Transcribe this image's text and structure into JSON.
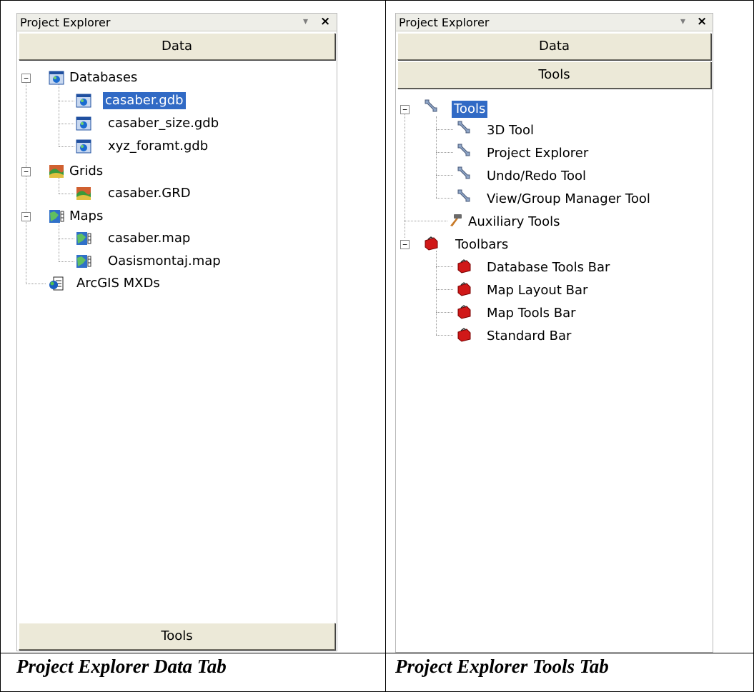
{
  "left_panel": {
    "title": "Project Explorer",
    "pin_glyph": "▾",
    "close_glyph": "×",
    "tab_top": "Data",
    "tab_bottom": "Tools",
    "tree": {
      "databases": "Databases",
      "db1": "casaber.gdb",
      "db2": "casaber_size.gdb",
      "db3": "xyz_foramt.gdb",
      "grids": "Grids",
      "grid1": "casaber.GRD",
      "maps": "Maps",
      "map1": "casaber.map",
      "map2": "Oasismontaj.map",
      "arcgis": "ArcGIS MXDs"
    }
  },
  "right_panel": {
    "title": "Project Explorer",
    "pin_glyph": "▾",
    "close_glyph": "×",
    "tab_data": "Data",
    "tab_tools": "Tools",
    "tree": {
      "tools": "Tools",
      "t1": "3D Tool",
      "t2": "Project Explorer",
      "t3": "Undo/Redo Tool",
      "t4": "View/Group Manager Tool",
      "aux": "Auxiliary Tools",
      "toolbars": "Toolbars",
      "b1": "Database Tools Bar",
      "b2": "Map Layout Bar",
      "b3": "Map Tools Bar",
      "b4": "Standard Bar"
    }
  },
  "captions": {
    "left": "Project Explorer Data Tab",
    "right": "Project Explorer Tools Tab"
  },
  "colors": {
    "selection": "#316ac5",
    "tab_face": "#ece9d8"
  }
}
